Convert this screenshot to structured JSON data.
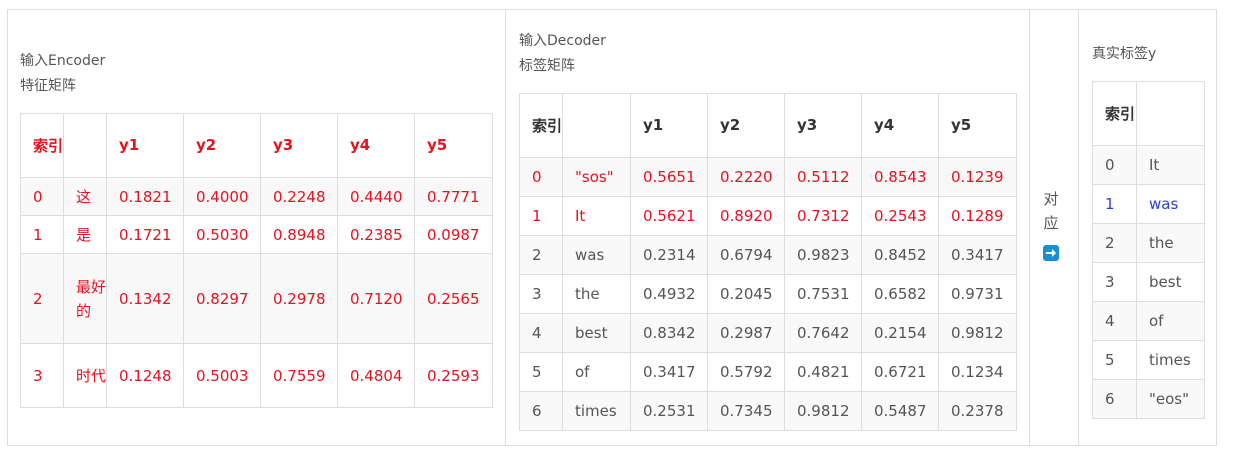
{
  "encoder": {
    "caption_line1": "输入Encoder",
    "caption_line2": "特征矩阵",
    "headers": [
      "索引",
      "",
      "y1",
      "y2",
      "y3",
      "y4",
      "y5"
    ],
    "rows": [
      {
        "idx": "0",
        "tok": "这",
        "vals": [
          "0.1821",
          "0.4000",
          "0.2248",
          "0.4440",
          "0.7771"
        ]
      },
      {
        "idx": "1",
        "tok": "是",
        "vals": [
          "0.1721",
          "0.5030",
          "0.8948",
          "0.2385",
          "0.0987"
        ]
      },
      {
        "idx": "2",
        "tok": "最好的",
        "vals": [
          "0.1342",
          "0.8297",
          "0.2978",
          "0.7120",
          "0.2565"
        ]
      },
      {
        "idx": "3",
        "tok": "时代",
        "vals": [
          "0.1248",
          "0.5003",
          "0.7559",
          "0.4804",
          "0.2593"
        ]
      }
    ]
  },
  "decoder": {
    "caption_line1": "输入Decoder",
    "caption_line2": "标签矩阵",
    "headers": [
      "索引",
      "",
      "y1",
      "y2",
      "y3",
      "y4",
      "y5"
    ],
    "rows": [
      {
        "idx": "0",
        "tok": "\"sos\"",
        "vals": [
          "0.5651",
          "0.2220",
          "0.5112",
          "0.8543",
          "0.1239"
        ]
      },
      {
        "idx": "1",
        "tok": "It",
        "vals": [
          "0.5621",
          "0.8920",
          "0.7312",
          "0.2543",
          "0.1289"
        ]
      },
      {
        "idx": "2",
        "tok": "was",
        "vals": [
          "0.2314",
          "0.6794",
          "0.9823",
          "0.8452",
          "0.3417"
        ]
      },
      {
        "idx": "3",
        "tok": "the",
        "vals": [
          "0.4932",
          "0.2045",
          "0.7531",
          "0.6582",
          "0.9731"
        ]
      },
      {
        "idx": "4",
        "tok": "best",
        "vals": [
          "0.8342",
          "0.2987",
          "0.7642",
          "0.2154",
          "0.9812"
        ]
      },
      {
        "idx": "5",
        "tok": "of",
        "vals": [
          "0.3417",
          "0.5792",
          "0.4821",
          "0.6721",
          "0.1234"
        ]
      },
      {
        "idx": "6",
        "tok": "times",
        "vals": [
          "0.2531",
          "0.7345",
          "0.9812",
          "0.5487",
          "0.2378"
        ]
      }
    ]
  },
  "mapping": {
    "line1": "对",
    "line2": "应",
    "icon": "right-arrow-icon"
  },
  "labels": {
    "caption": "真实标签y",
    "headers": [
      "索引",
      ""
    ],
    "rows": [
      {
        "idx": "0",
        "tok": "It"
      },
      {
        "idx": "1",
        "tok": "was"
      },
      {
        "idx": "2",
        "tok": "the"
      },
      {
        "idx": "3",
        "tok": "best"
      },
      {
        "idx": "4",
        "tok": "of"
      },
      {
        "idx": "5",
        "tok": "times"
      },
      {
        "idx": "6",
        "tok": "\"eos\""
      }
    ]
  },
  "colors": {
    "highlight_red": "#e8111f",
    "highlight_blue": "#2c3ee0",
    "icon_blue": "#1a8fd6",
    "border": "#dddddd",
    "stripe": "#f9f9f9"
  }
}
